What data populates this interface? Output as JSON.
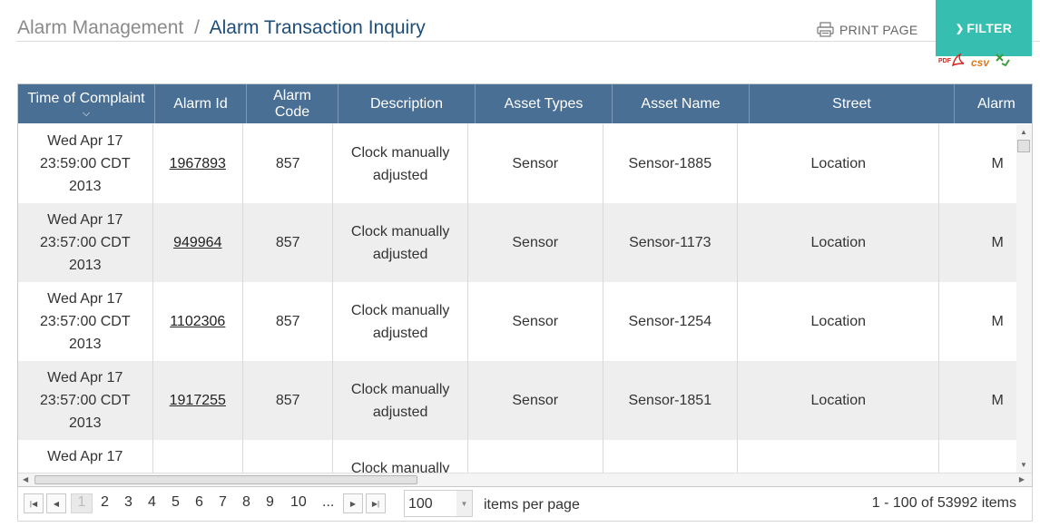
{
  "header": {
    "breadcrumb_parent": "Alarm Management",
    "breadcrumb_separator": "/",
    "breadcrumb_current": "Alarm Transaction Inquiry",
    "print_label": "PRINT PAGE",
    "print_icon": "printer-icon",
    "filter_label": "FILTER",
    "filter_icon": "chevron-down-icon",
    "filter_color": "#36bfb0"
  },
  "exports": {
    "pdf_label": "PDF",
    "csv_label": "csv"
  },
  "grid": {
    "header_color": "#4a6f95",
    "columns": [
      {
        "label": "Time of Complaint",
        "sort_icon": "chevron-down-icon"
      },
      {
        "label": "Alarm Id"
      },
      {
        "label": "Alarm Code"
      },
      {
        "label": "Description"
      },
      {
        "label": "Asset Types"
      },
      {
        "label": "Asset Name"
      },
      {
        "label": "Street"
      },
      {
        "label": "Alarm"
      }
    ],
    "rows": [
      {
        "time_line1": "Wed Apr 17",
        "time_line2": "23:59:00 CDT",
        "time_line3": "2013",
        "alarm_id": "1967893",
        "code": "857",
        "desc_line1": "Clock manually",
        "desc_line2": "adjusted",
        "asset_type": "Sensor",
        "asset_name": "Sensor-1885",
        "street": "Location",
        "alarm": "M"
      },
      {
        "time_line1": "Wed Apr 17",
        "time_line2": "23:57:00 CDT",
        "time_line3": "2013",
        "alarm_id": "949964",
        "code": "857",
        "desc_line1": "Clock manually",
        "desc_line2": "adjusted",
        "asset_type": "Sensor",
        "asset_name": "Sensor-1173",
        "street": "Location",
        "alarm": "M"
      },
      {
        "time_line1": "Wed Apr 17",
        "time_line2": "23:57:00 CDT",
        "time_line3": "2013",
        "alarm_id": "1102306",
        "code": "857",
        "desc_line1": "Clock manually",
        "desc_line2": "adjusted",
        "asset_type": "Sensor",
        "asset_name": "Sensor-1254",
        "street": "Location",
        "alarm": "M"
      },
      {
        "time_line1": "Wed Apr 17",
        "time_line2": "23:57:00 CDT",
        "time_line3": "2013",
        "alarm_id": "1917255",
        "code": "857",
        "desc_line1": "Clock manually",
        "desc_line2": "adjusted",
        "asset_type": "Sensor",
        "asset_name": "Sensor-1851",
        "street": "Location",
        "alarm": "M"
      },
      {
        "time_line1": "Wed Apr 17",
        "time_line2": "",
        "time_line3": "",
        "alarm_id": "",
        "code": "",
        "desc_line1": "Clock manually",
        "desc_line2": "",
        "asset_type": "",
        "asset_name": "",
        "street": "",
        "alarm": ""
      }
    ]
  },
  "pager": {
    "current_page": "1",
    "pages": [
      "2",
      "3",
      "4",
      "5",
      "6",
      "7",
      "8",
      "9",
      "10",
      "..."
    ],
    "page_size": "100",
    "page_size_label": "items per page",
    "info": "1 - 100 of 53992 items"
  }
}
